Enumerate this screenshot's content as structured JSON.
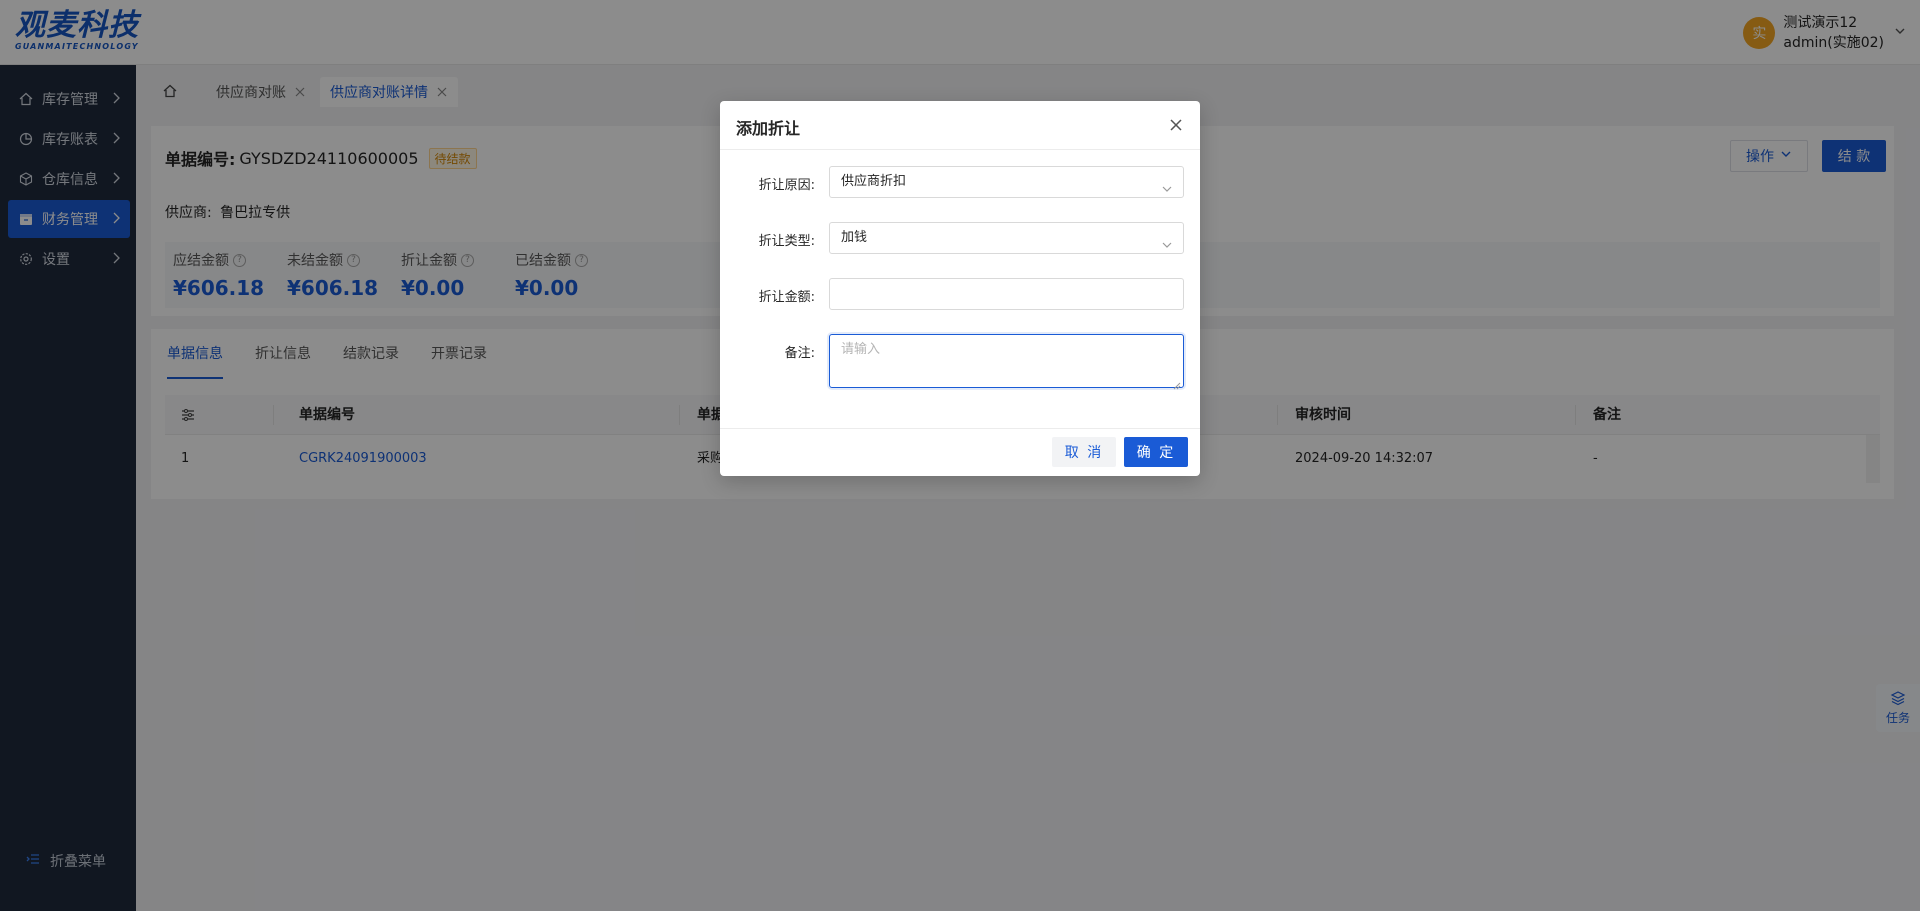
{
  "header": {
    "logo_main": "观麦科技",
    "logo_sub": "GUANMAITECHNOLOGY",
    "avatar_char": "实",
    "user_line1": "测试演示12",
    "user_line2": "admin(实施02)"
  },
  "sidebar": {
    "items": [
      {
        "label": "库存管理",
        "icon": "home-icon"
      },
      {
        "label": "库存账表",
        "icon": "pie-chart-icon"
      },
      {
        "label": "仓库信息",
        "icon": "cube-icon"
      },
      {
        "label": "财务管理",
        "icon": "finance-icon"
      },
      {
        "label": "设置",
        "icon": "gear-icon"
      }
    ],
    "active_index": 3,
    "collapse_label": "折叠菜单"
  },
  "tabs": {
    "items": [
      {
        "label": "供应商对账"
      },
      {
        "label": "供应商对账详情"
      }
    ],
    "active_index": 1
  },
  "doc": {
    "number_label": "单据编号:",
    "number_value": "GYSDZD24110600005",
    "status": "待结款",
    "supplier_label": "供应商:",
    "supplier_value": "鲁巴拉专供",
    "ops_label": "操作",
    "settle_label": "结 款",
    "stats": [
      {
        "label": "应结金额",
        "value": "¥606.18"
      },
      {
        "label": "未结金额",
        "value": "¥606.18"
      },
      {
        "label": "折让金额",
        "value": "¥0.00"
      },
      {
        "label": "已结金额",
        "value": "¥0.00"
      }
    ]
  },
  "detail": {
    "tabs": [
      "单据信息",
      "折让信息",
      "结款记录",
      "开票记录"
    ],
    "active_tab": 0,
    "columns": [
      "单据编号",
      "单据",
      "审核时间",
      "备注"
    ],
    "rows": [
      {
        "idx": "1",
        "number": "CGRK24091900003",
        "type": "采购",
        "audit_time": "2024-09-20 14:32:07",
        "remark": "-"
      }
    ]
  },
  "task_float": {
    "label": "任务"
  },
  "modal": {
    "title": "添加折让",
    "fields": {
      "reason_label": "折让原因:",
      "reason_value": "供应商折扣",
      "type_label": "折让类型:",
      "type_value": "加钱",
      "amount_label": "折让金额:",
      "amount_value": "",
      "remark_label": "备注:",
      "remark_placeholder": "请输入"
    },
    "cancel_label": "取 消",
    "ok_label": "确 定"
  },
  "colors": {
    "primary": "#1a5bd6",
    "sidebar_bg": "#1f2a3d",
    "status_orange": "#d48806"
  }
}
